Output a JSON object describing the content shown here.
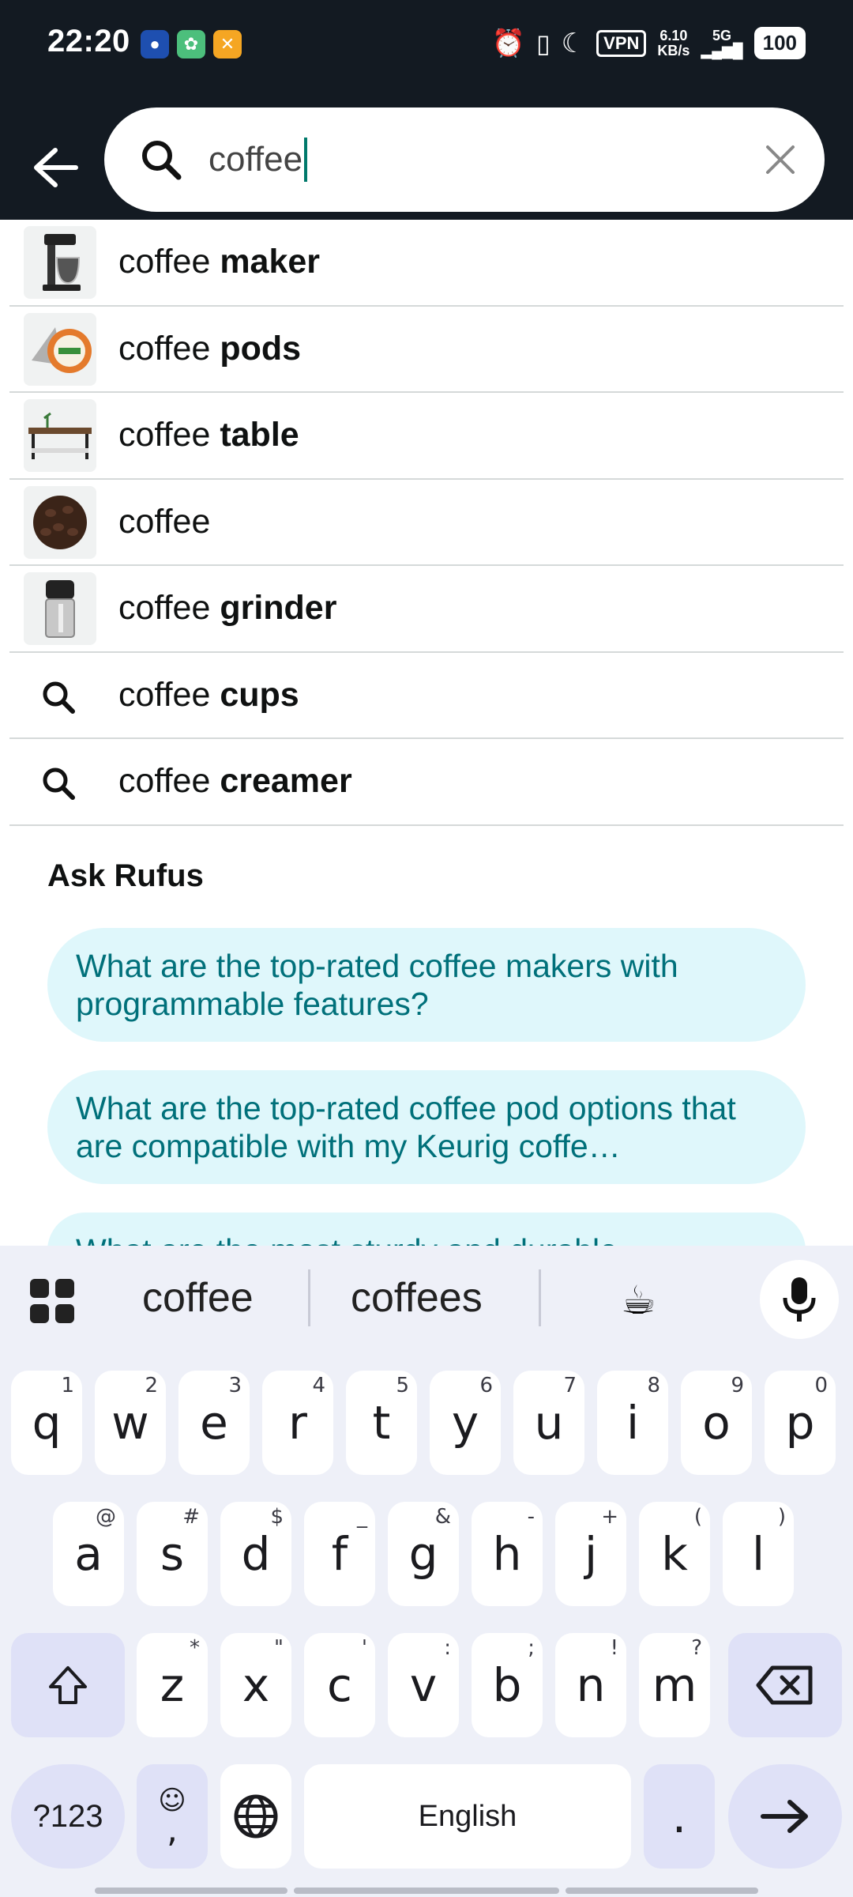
{
  "status_bar": {
    "time": "22:20",
    "vpn": "VPN",
    "speed_value": "6.10",
    "speed_unit": "KB/s",
    "network": "5G",
    "battery": "100"
  },
  "search": {
    "query": "coffee",
    "icon": "search-icon"
  },
  "suggestions": [
    {
      "prefix": "coffee",
      "bold": "maker",
      "icon": "coffee-maker-thumbnail"
    },
    {
      "prefix": "coffee",
      "bold": "pods",
      "icon": "coffee-pods-thumbnail"
    },
    {
      "prefix": "coffee",
      "bold": "table",
      "icon": "coffee-table-thumbnail"
    },
    {
      "prefix": "coffee",
      "bold": "",
      "icon": "coffee-beans-thumbnail"
    },
    {
      "prefix": "coffee",
      "bold": "grinder",
      "icon": "coffee-grinder-thumbnail"
    },
    {
      "prefix": "coffee",
      "bold": "cups",
      "icon": "search-icon"
    },
    {
      "prefix": "coffee",
      "bold": "creamer",
      "icon": "search-icon"
    }
  ],
  "rufus": {
    "title": "Ask Rufus",
    "questions": [
      "What are the top-rated coffee makers with programmable features?",
      "What are the top-rated coffee pod options that are compatible with my Keurig coffe…",
      "What are the most sturdy and durable"
    ]
  },
  "keyboard": {
    "suggestions": [
      "coffee",
      "coffees"
    ],
    "emoji": "☕",
    "row1": [
      {
        "k": "q",
        "h": "1"
      },
      {
        "k": "w",
        "h": "2"
      },
      {
        "k": "e",
        "h": "3"
      },
      {
        "k": "r",
        "h": "4"
      },
      {
        "k": "t",
        "h": "5"
      },
      {
        "k": "y",
        "h": "6"
      },
      {
        "k": "u",
        "h": "7"
      },
      {
        "k": "i",
        "h": "8"
      },
      {
        "k": "o",
        "h": "9"
      },
      {
        "k": "p",
        "h": "0"
      }
    ],
    "row2": [
      {
        "k": "a",
        "h": "@"
      },
      {
        "k": "s",
        "h": "#"
      },
      {
        "k": "d",
        "h": "$"
      },
      {
        "k": "f",
        "h": "_"
      },
      {
        "k": "g",
        "h": "&"
      },
      {
        "k": "h",
        "h": "-"
      },
      {
        "k": "j",
        "h": "+"
      },
      {
        "k": "k",
        "h": "("
      },
      {
        "k": "l",
        "h": ")"
      }
    ],
    "row3": [
      {
        "k": "z",
        "h": "*"
      },
      {
        "k": "x",
        "h": "\""
      },
      {
        "k": "c",
        "h": "'"
      },
      {
        "k": "v",
        "h": ":"
      },
      {
        "k": "b",
        "h": ";"
      },
      {
        "k": "n",
        "h": "!"
      },
      {
        "k": "m",
        "h": "?"
      }
    ],
    "symbols_key": "?123",
    "comma_key": ",",
    "space_label": "English",
    "period_key": "."
  },
  "colors": {
    "header_bg": "#131a22",
    "rufus_chip_bg": "#dff7fb",
    "rufus_text": "#00707a",
    "modifier_key_bg": "#dfe1f7"
  }
}
